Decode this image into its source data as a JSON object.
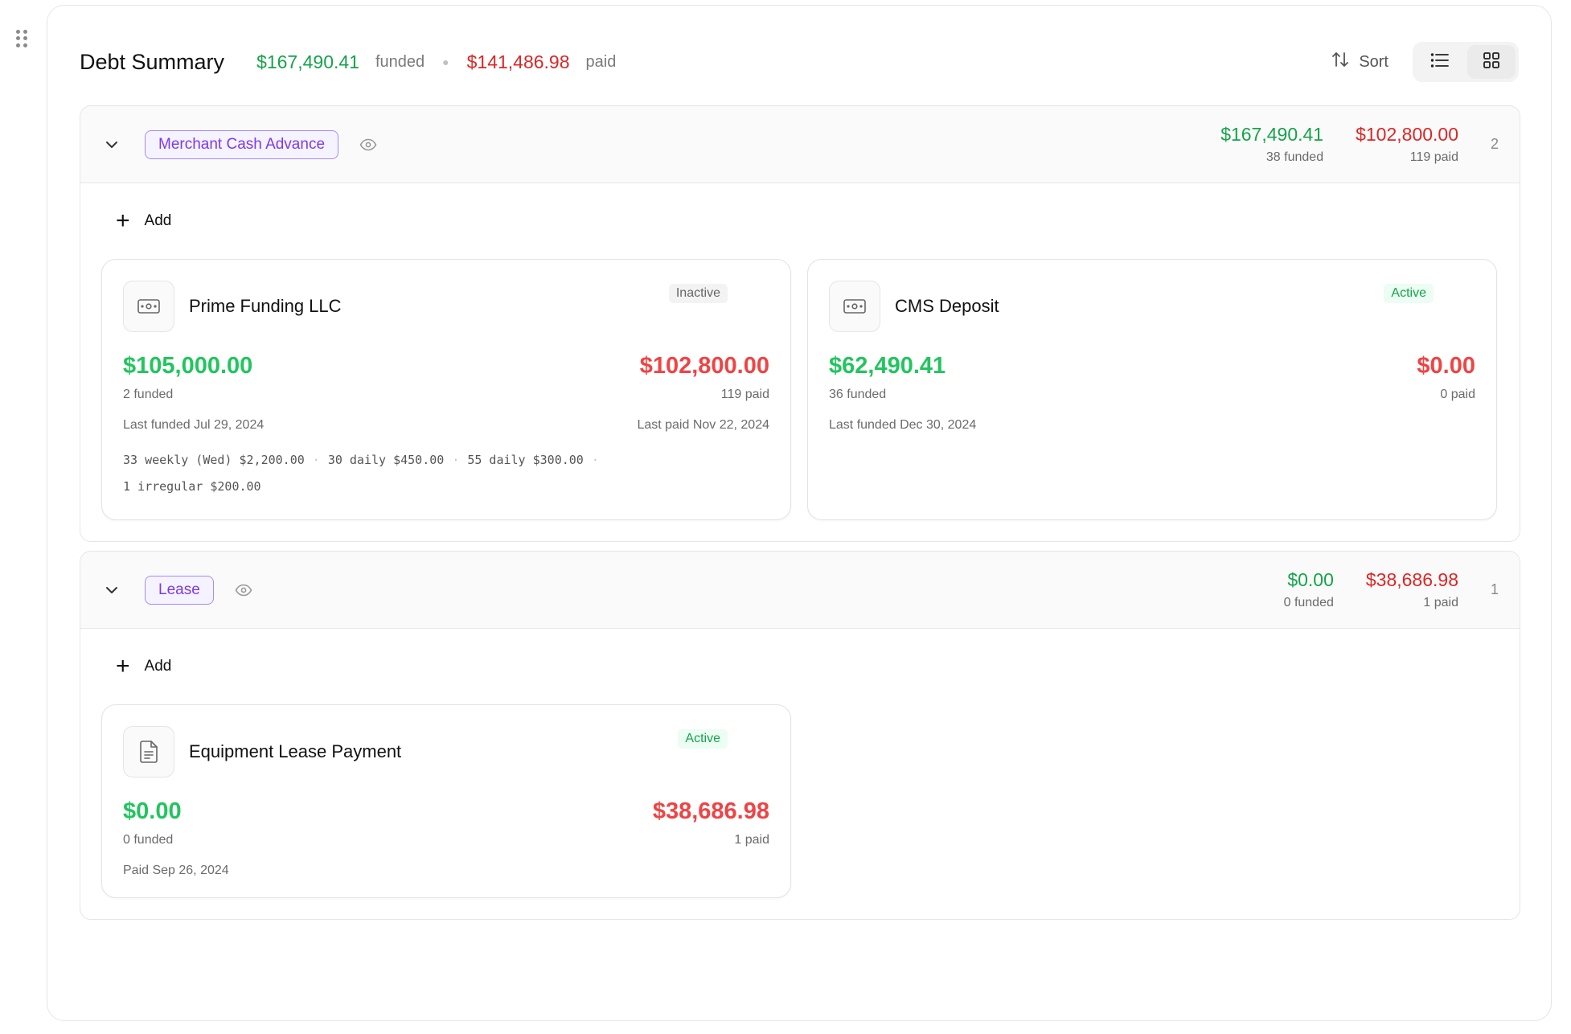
{
  "header": {
    "title": "Debt Summary",
    "funded_amount": "$167,490.41",
    "funded_label": "funded",
    "paid_amount": "$141,486.98",
    "paid_label": "paid",
    "sort_label": "Sort"
  },
  "groups": [
    {
      "label": "Merchant Cash Advance",
      "funded_amount": "$167,490.41",
      "funded_sub": "38 funded",
      "paid_amount": "$102,800.00",
      "paid_sub": "119 paid",
      "count": "2",
      "add_label": "Add",
      "cards": [
        {
          "name": "Prime Funding LLC",
          "status": "Inactive",
          "icon": "banknote-icon",
          "funded": "$105,000.00",
          "funded_sub": "2 funded",
          "paid": "$102,800.00",
          "paid_sub": "119 paid",
          "last_funded": "Last funded Jul 29, 2024",
          "last_paid": "Last paid Nov 22, 2024",
          "schedule": [
            "33 weekly (Wed) $2,200.00",
            "30 daily $450.00",
            "55 daily $300.00",
            "1 irregular $200.00"
          ]
        },
        {
          "name": "CMS Deposit",
          "status": "Active",
          "icon": "banknote-icon",
          "funded": "$62,490.41",
          "funded_sub": "36 funded",
          "paid": "$0.00",
          "paid_sub": "0 paid",
          "last_funded": "Last funded Dec 30, 2024"
        }
      ]
    },
    {
      "label": "Lease",
      "funded_amount": "$0.00",
      "funded_sub": "0 funded",
      "paid_amount": "$38,686.98",
      "paid_sub": "1 paid",
      "count": "1",
      "add_label": "Add",
      "cards": [
        {
          "name": "Equipment Lease Payment",
          "status": "Active",
          "icon": "document-icon",
          "funded": "$0.00",
          "funded_sub": "0 funded",
          "paid": "$38,686.98",
          "paid_sub": "1 paid",
          "last_funded": "Paid Sep 26, 2024"
        }
      ]
    }
  ],
  "colors": {
    "funded": "#16a34a",
    "paid": "#dc2626",
    "category_accent": "#7c3aed",
    "active": "#16a34a"
  }
}
